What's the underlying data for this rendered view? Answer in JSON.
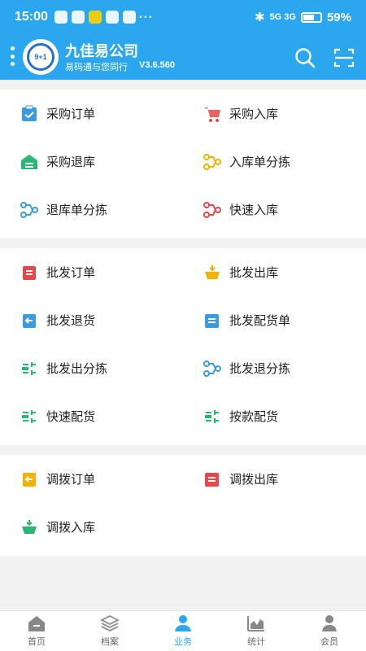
{
  "status_bar": {
    "time": "15:00",
    "dots": "···",
    "network": "5G 3G",
    "battery": "59%",
    "battery_level": 0.59
  },
  "header": {
    "company": "九佳易公司",
    "slogan": "易码通与您同行",
    "version": "V3.6.560",
    "logo_text": "9+1"
  },
  "sections": [
    {
      "items": [
        {
          "label": "采购订单",
          "icon": "purchase-order-icon",
          "color": "#3a9be0"
        },
        {
          "label": "采购入库",
          "icon": "purchase-inbound-icon",
          "color": "#e8474b"
        },
        {
          "label": "采购退库",
          "icon": "purchase-return-icon",
          "color": "#2bb673"
        },
        {
          "label": "入库单分拣",
          "icon": "inbound-sort-icon",
          "color": "#f2b200"
        },
        {
          "label": "退库单分拣",
          "icon": "return-sort-icon",
          "color": "#3a9be0"
        },
        {
          "label": "快速入库",
          "icon": "quick-inbound-icon",
          "color": "#e8474b"
        }
      ]
    },
    {
      "items": [
        {
          "label": "批发订单",
          "icon": "wholesale-order-icon",
          "color": "#e8474b"
        },
        {
          "label": "批发出库",
          "icon": "wholesale-outbound-icon",
          "color": "#f2b200"
        },
        {
          "label": "批发退货",
          "icon": "wholesale-return-icon",
          "color": "#3a9be0"
        },
        {
          "label": "批发配货单",
          "icon": "wholesale-allocation-icon",
          "color": "#3a9be0"
        },
        {
          "label": "批发出分拣",
          "icon": "wholesale-out-sort-icon",
          "color": "#2bb673"
        },
        {
          "label": "批发退分拣",
          "icon": "wholesale-return-sort-icon",
          "color": "#3a9be0"
        },
        {
          "label": "快速配货",
          "icon": "quick-allocation-icon",
          "color": "#2bb673"
        },
        {
          "label": "按款配货",
          "icon": "style-allocation-icon",
          "color": "#2bb673"
        }
      ]
    },
    {
      "items": [
        {
          "label": "调拨订单",
          "icon": "transfer-order-icon",
          "color": "#f2b200"
        },
        {
          "label": "调拨出库",
          "icon": "transfer-outbound-icon",
          "color": "#e8474b"
        },
        {
          "label": "调拨入库",
          "icon": "transfer-inbound-icon",
          "color": "#2bb673"
        }
      ]
    }
  ],
  "tabs": [
    {
      "label": "首页",
      "icon": "home-icon",
      "active": false
    },
    {
      "label": "档案",
      "icon": "archive-layers-icon",
      "active": false
    },
    {
      "label": "业务",
      "icon": "business-user-icon",
      "active": true
    },
    {
      "label": "统计",
      "icon": "statistics-chart-icon",
      "active": false
    },
    {
      "label": "会员",
      "icon": "member-icon",
      "active": false
    }
  ]
}
